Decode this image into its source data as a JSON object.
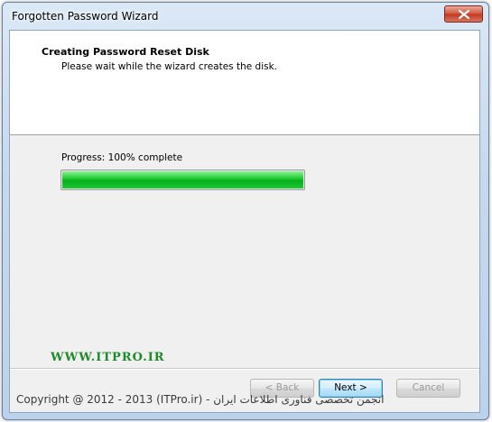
{
  "window": {
    "title": "Forgotten Password Wizard"
  },
  "header": {
    "title": "Creating Password Reset Disk",
    "subtitle": "Please wait while the wizard creates the disk."
  },
  "progress": {
    "label": "Progress: 100% complete",
    "value_percent": 100,
    "color": "#06b01c"
  },
  "buttons": {
    "back_label": "< Back",
    "next_label": "Next >",
    "cancel_label": "Cancel"
  },
  "watermark": {
    "url": "WWW.ITPRO.IR",
    "copyright": "Copyright @ 2012 - 2013 (ITPro.ir) - انجمن تخصصی فناوری اطلاعات ایران"
  },
  "icons": {
    "close": "close-icon"
  }
}
